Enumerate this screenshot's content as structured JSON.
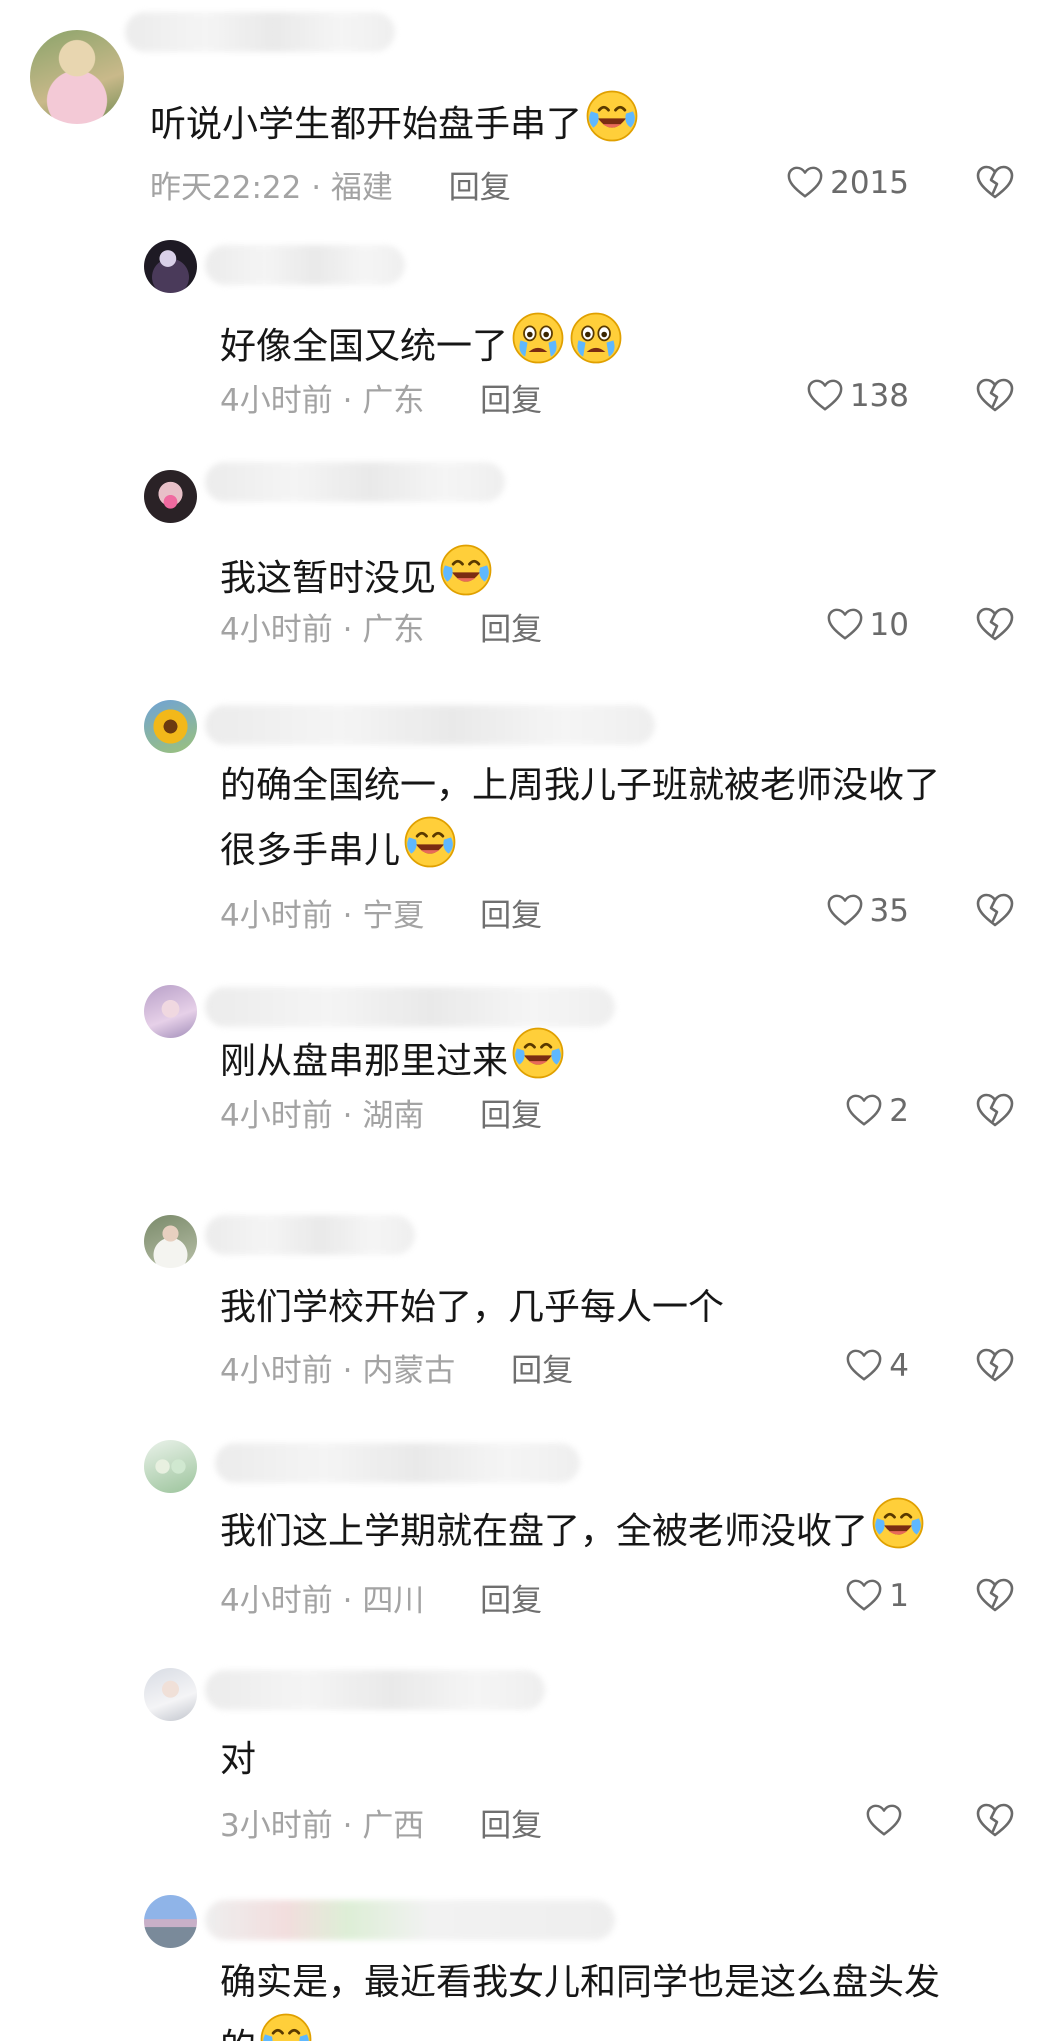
{
  "comments": [
    {
      "text_lines": [
        "听说小学生都开始盘手串了"
      ],
      "emoji": "grinning-tears-emoji",
      "time": "昨天22:22",
      "location": "福建",
      "reply_label": "回复",
      "likes": "2015"
    },
    {
      "text_lines": [
        "好像全国又统一了"
      ],
      "emoji": "crying-face-emoji-x2",
      "time": "4小时前",
      "location": "广东",
      "reply_label": "回复",
      "likes": "138"
    },
    {
      "text_lines": [
        "我这暂时没见"
      ],
      "emoji": "grinning-tears-emoji",
      "time": "4小时前",
      "location": "广东",
      "reply_label": "回复",
      "likes": "10"
    },
    {
      "text_lines": [
        "的确全国统一，上周我儿子班就被老师没收了",
        "很多手串儿"
      ],
      "emoji": "grinning-tears-emoji",
      "time": "4小时前",
      "location": "宁夏",
      "reply_label": "回复",
      "likes": "35"
    },
    {
      "text_lines": [
        "刚从盘串那里过来"
      ],
      "emoji": "grinning-tears-emoji",
      "time": "4小时前",
      "location": "湖南",
      "reply_label": "回复",
      "likes": "2"
    },
    {
      "text_lines": [
        "我们学校开始了，几乎每人一个"
      ],
      "emoji": "",
      "time": "4小时前",
      "location": "内蒙古",
      "reply_label": "回复",
      "likes": "4"
    },
    {
      "text_lines": [
        "我们这上学期就在盘了，全被老师没收了"
      ],
      "emoji": "grinning-tears-emoji",
      "time": "4小时前",
      "location": "四川",
      "reply_label": "回复",
      "likes": "1"
    },
    {
      "text_lines": [
        "对"
      ],
      "emoji": "",
      "time": "3小时前",
      "location": "广西",
      "reply_label": "回复",
      "likes": ""
    },
    {
      "text_lines": [
        "确实是，最近看我女儿和同学也是这么盘头发",
        "的"
      ],
      "emoji": "grinning-tears-emoji",
      "time": "",
      "location": "",
      "reply_label": "",
      "likes": ""
    }
  ],
  "meta_separator": "·",
  "icons": {
    "like": "heart-outline-icon",
    "dislike": "broken-heart-icon"
  },
  "colors": {
    "text": "#161616",
    "meta": "#a3a3a3",
    "reply": "#6f6f6f",
    "icon": "#6a6a6a"
  }
}
